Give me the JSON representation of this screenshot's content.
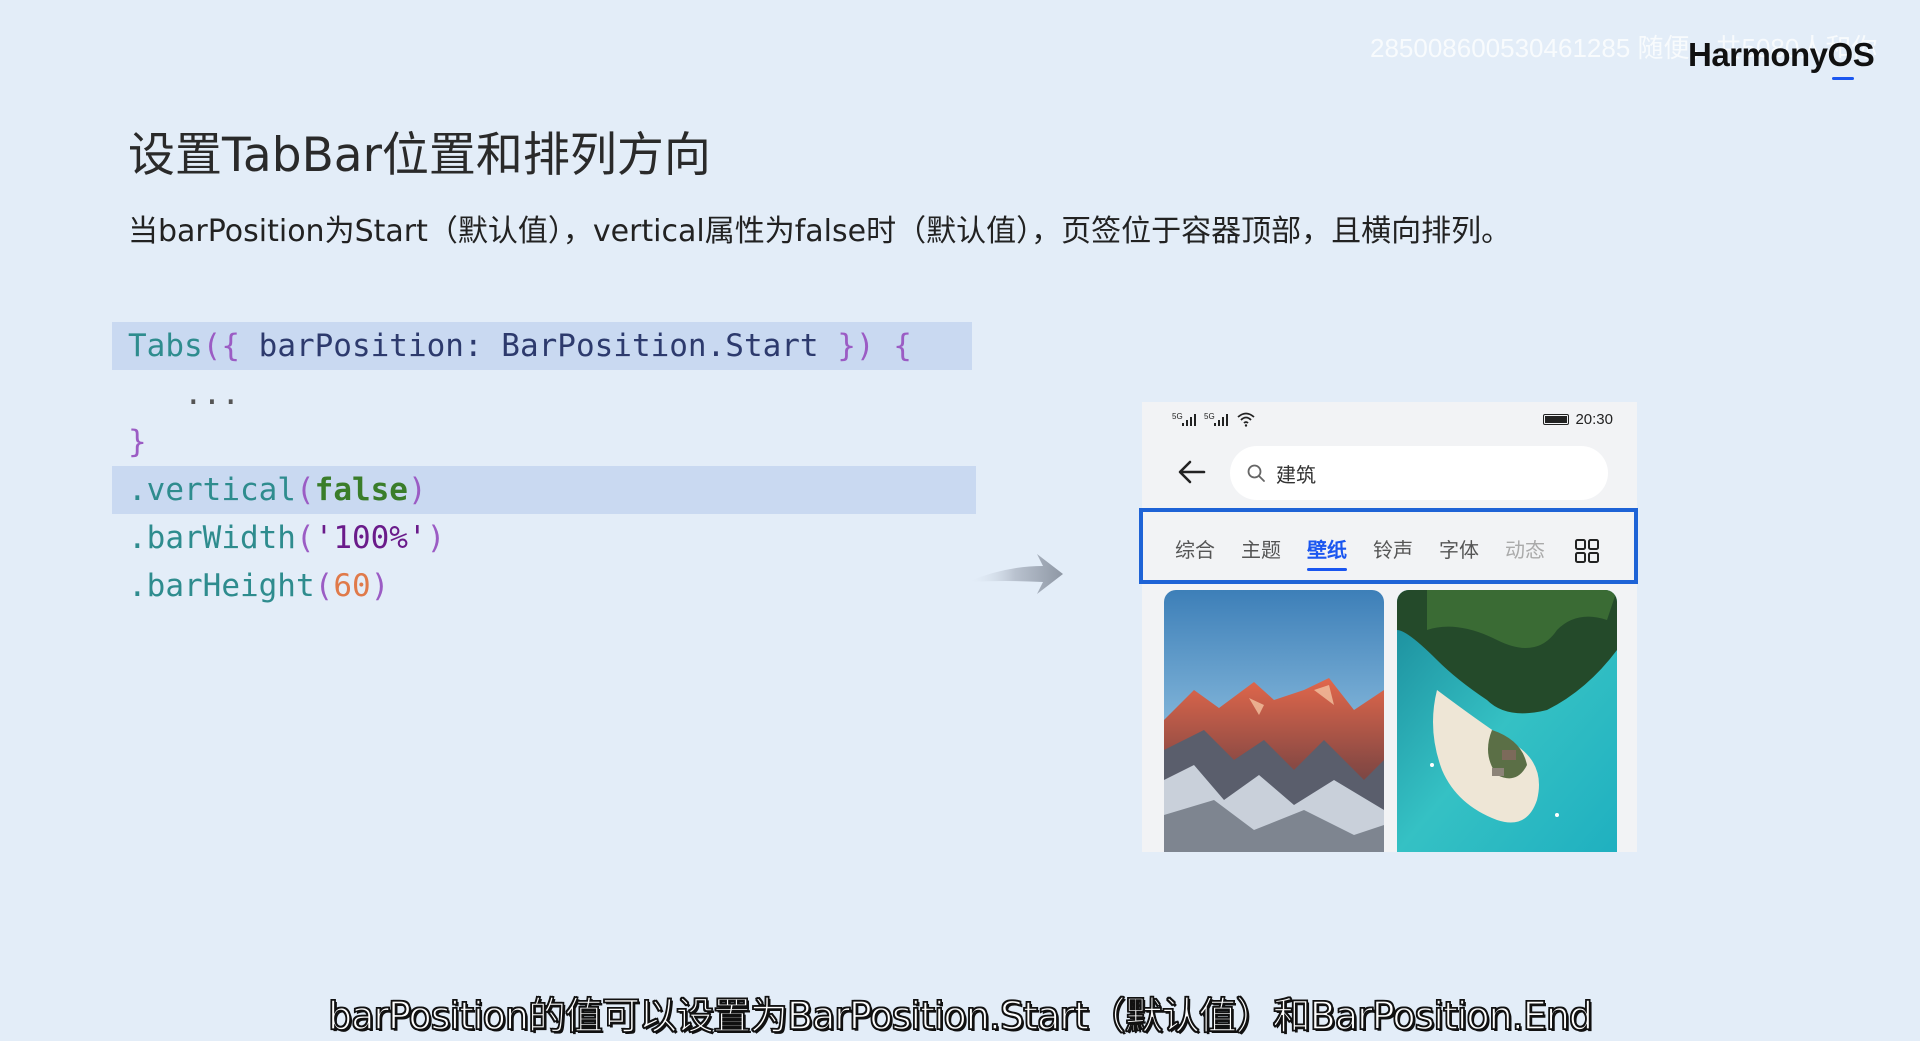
{
  "watermark": "285008600530461285 随便，共5080人和你",
  "brand": "HarmonyOS",
  "slide": {
    "title": "设置TabBar位置和排列方向",
    "subtitle": "当barPosition为Start（默认值），vertical属性为false时（默认值），页签位于容器顶部，且横向排列。"
  },
  "code": {
    "line1": {
      "tabs": "Tabs",
      "open": "({ ",
      "prop": "barPosition",
      "colon": ": ",
      "enum": "BarPosition",
      "dot": ".",
      "member": "Start",
      "close": " }) {"
    },
    "line2": "   ...",
    "line3": "}",
    "line4": {
      "method": ".vertical",
      "open": "(",
      "arg": "false",
      "close": ")"
    },
    "line5": {
      "method": ".barWidth",
      "open": "(",
      "arg": "'100%'",
      "close": ")"
    },
    "line6": {
      "method": ".barHeight",
      "open": "(",
      "arg": "60",
      "close": ")"
    }
  },
  "phone": {
    "status": {
      "signal1": "5G",
      "signal2": "5G",
      "time": "20:30"
    },
    "search": {
      "value": "建筑"
    },
    "tabs": [
      {
        "label": "综合"
      },
      {
        "label": "主题"
      },
      {
        "label": "壁纸",
        "active": true
      },
      {
        "label": "铃声"
      },
      {
        "label": "字体"
      },
      {
        "label": "动态"
      }
    ]
  },
  "caption": "barPosition的值可以设置为BarPosition.Start（默认值）和BarPosition.End",
  "colors": {
    "background": "#e3edf8",
    "accent": "#1a56f0",
    "highlight_frame": "#1e63d6",
    "code_highlight": "#c9d9f1"
  },
  "icons": [
    "back-arrow-icon",
    "search-icon",
    "grid-icon",
    "wifi-icon",
    "battery-icon",
    "signal-icon",
    "arrow-right-icon"
  ]
}
